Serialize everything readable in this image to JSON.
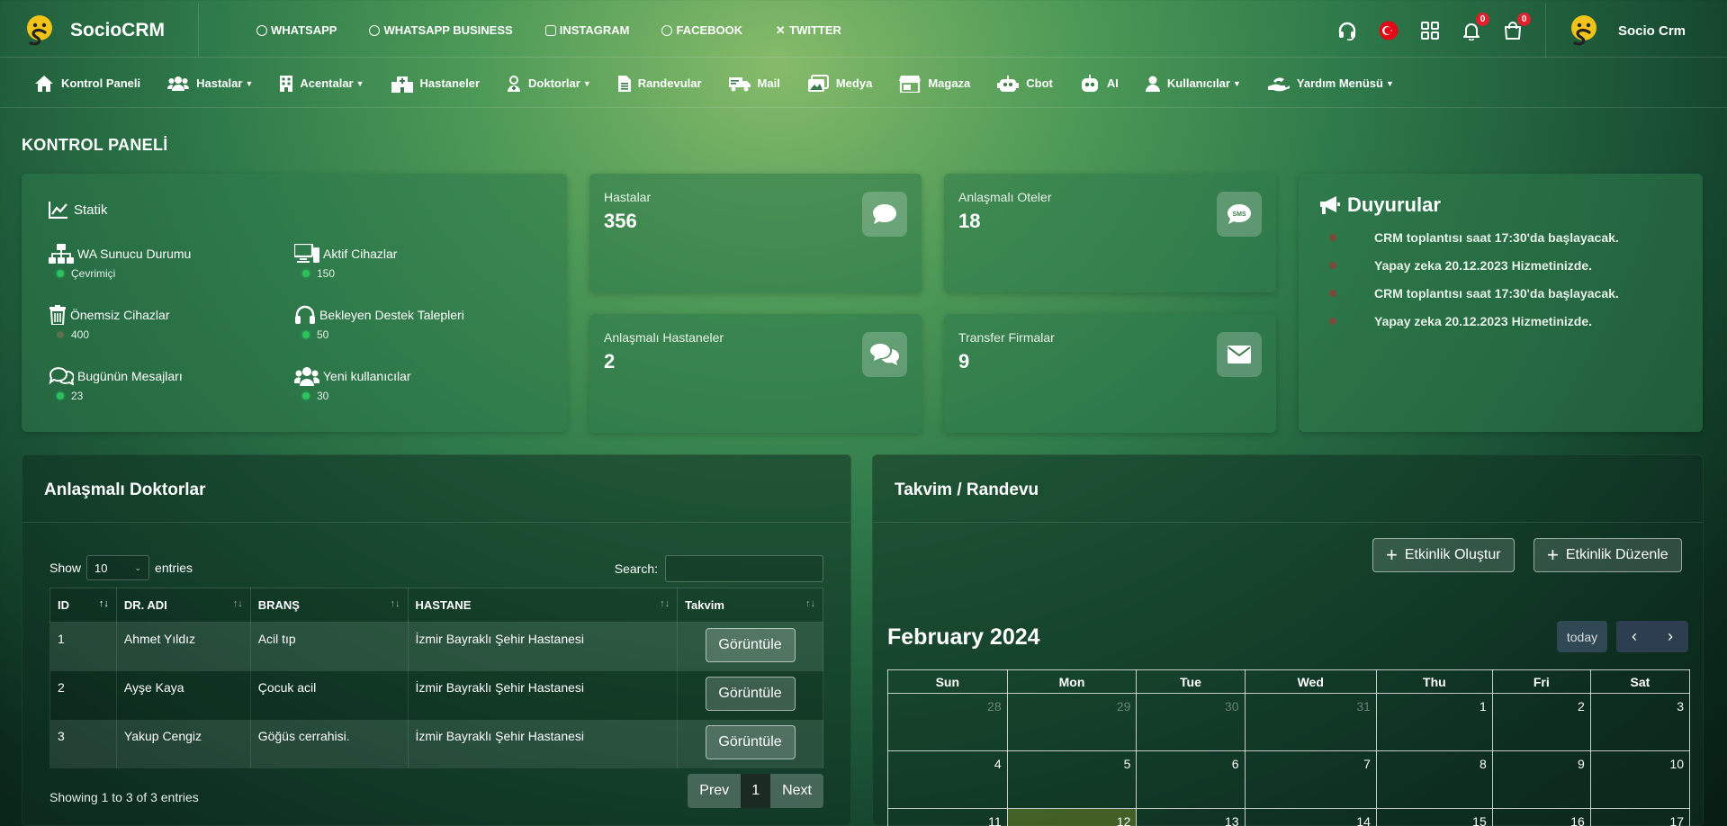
{
  "brand": {
    "name": "SocioCRM"
  },
  "social_links": [
    {
      "label": "WHATSAPP",
      "icon": "whatsapp-icon"
    },
    {
      "label": "WHATSAPP BUSINESS",
      "icon": "whatsapp-business-icon"
    },
    {
      "label": "INSTAGRAM",
      "icon": "instagram-icon"
    },
    {
      "label": "FACEBOOK",
      "icon": "facebook-icon"
    },
    {
      "label": "TWITTER",
      "icon": "twitter-x-icon"
    }
  ],
  "topbar": {
    "notifications_count": "0",
    "cart_count": "0",
    "user_name": "Socio Crm"
  },
  "menu": [
    {
      "label": "Kontrol Paneli",
      "dropdown": false
    },
    {
      "label": "Hastalar",
      "dropdown": true
    },
    {
      "label": "Acentalar",
      "dropdown": true
    },
    {
      "label": "Hastaneler",
      "dropdown": false
    },
    {
      "label": "Doktorlar",
      "dropdown": true
    },
    {
      "label": "Randevular",
      "dropdown": false
    },
    {
      "label": "Mail",
      "dropdown": false
    },
    {
      "label": "Medya",
      "dropdown": false
    },
    {
      "label": "Magaza",
      "dropdown": false
    },
    {
      "label": "Cbot",
      "dropdown": false
    },
    {
      "label": "AI",
      "dropdown": false
    },
    {
      "label": "Kullanıcılar",
      "dropdown": true
    },
    {
      "label": "Yardım Menüsü",
      "dropdown": true
    }
  ],
  "page_title": "KONTROL PANELİ",
  "stats": {
    "heading": "Statik",
    "items": [
      {
        "label": "WA Sunucu Durumu",
        "value": "Çevrimiçi",
        "status": "online"
      },
      {
        "label": "Aktif Cihazlar",
        "value": "150",
        "status": "online"
      },
      {
        "label": "Önemsiz Cihazlar",
        "value": "400",
        "status": "offline"
      },
      {
        "label": "Bekleyen Destek Talepleri",
        "value": "50",
        "status": "online"
      },
      {
        "label": "Bugünün Mesajları",
        "value": "23",
        "status": "online"
      },
      {
        "label": "Yeni kullanıcılar",
        "value": "30",
        "status": "online"
      }
    ]
  },
  "mini_cards": [
    {
      "label": "Hastalar",
      "value": "356",
      "icon": "chat-bubble-icon"
    },
    {
      "label": "Anlaşmalı Oteler",
      "value": "18",
      "icon": "sms-icon"
    },
    {
      "label": "Anlaşmalı Hastaneler",
      "value": "2",
      "icon": "comments-icon"
    },
    {
      "label": "Transfer Firmalar",
      "value": "9",
      "icon": "envelope-icon"
    }
  ],
  "announcements": {
    "title": "Duyurular",
    "items": [
      "CRM toplantısı saat 17:30'da başlayacak.",
      "Yapay zeka 20.12.2023 Hizmetinizde.",
      "CRM toplantısı saat 17:30'da başlayacak.",
      "Yapay zeka 20.12.2023 Hizmetinizde."
    ]
  },
  "doctors": {
    "title": "Anlaşmalı Doktorlar",
    "show_label": "Show",
    "entries_value": "10",
    "entries_label": "entries",
    "search_label": "Search:",
    "columns": [
      "ID",
      "DR. ADI",
      "BRANŞ",
      "HASTANE",
      "Takvim"
    ],
    "rows": [
      {
        "id": "1",
        "name": "Ahmet Yıldız",
        "branch": "Acil tıp",
        "hospital": "İzmir Bayraklı Şehir Hastanesi",
        "action": "Görüntüle"
      },
      {
        "id": "2",
        "name": "Ayşe Kaya",
        "branch": "Çocuk acil",
        "hospital": "İzmir Bayraklı Şehir Hastanesi",
        "action": "Görüntüle"
      },
      {
        "id": "3",
        "name": "Yakup Cengiz",
        "branch": "Göğüs cerrahisi.",
        "hospital": "İzmir Bayraklı Şehir Hastanesi",
        "action": "Görüntüle"
      }
    ],
    "info": "Showing 1 to 3 of 3 entries",
    "pager": {
      "prev": "Prev",
      "current": "1",
      "next": "Next"
    }
  },
  "calendar": {
    "title": "Takvim / Randevu",
    "create_btn": "Etkinlik Oluştur",
    "edit_btn": "Etkinlik Düzenle",
    "month": "February 2024",
    "today_btn": "today",
    "weekdays": [
      "Sun",
      "Mon",
      "Tue",
      "Wed",
      "Thu",
      "Fri",
      "Sat"
    ],
    "weeks": [
      [
        "28",
        "29",
        "30",
        "31",
        "1",
        "2",
        "3"
      ],
      [
        "4",
        "5",
        "6",
        "7",
        "8",
        "9",
        "10"
      ],
      [
        "11",
        "12",
        "13",
        "14",
        "15",
        "16",
        "17"
      ]
    ],
    "other_month_cells": [
      "0-0",
      "0-1",
      "0-2",
      "0-3"
    ],
    "today_cell": "2-1"
  }
}
